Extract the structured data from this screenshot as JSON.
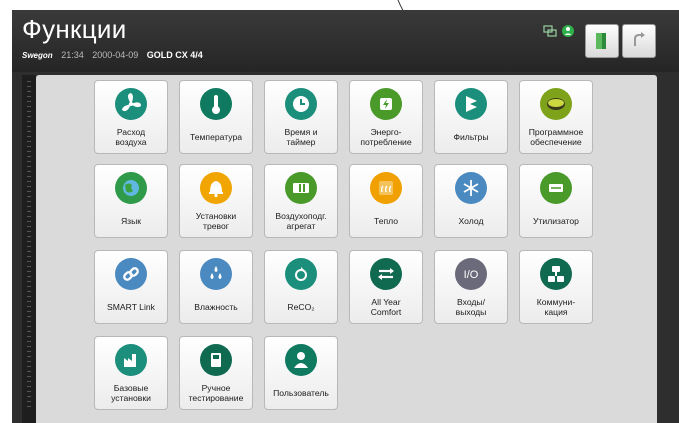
{
  "header": {
    "title": "Функции",
    "logo": "Swegon",
    "time": "21:34",
    "date": "2000-04-09",
    "model": "GOLD CX 4/4"
  },
  "status": {
    "network_icon": "network-icon",
    "user_icon": "user-status-icon"
  },
  "toolbar": {
    "exit_icon": "exit-door-icon",
    "back_icon": "back-arrow-icon"
  },
  "colors": {
    "tile_icon": "#0f7a60",
    "panel": "#dadada",
    "frame": "#2e2e2e"
  },
  "tiles": [
    {
      "label": "Расход\nвоздуха",
      "icon": "fan-icon",
      "color": "#1b8f7b"
    },
    {
      "label": "Температура",
      "icon": "thermometer-icon",
      "color": "#0f7a60"
    },
    {
      "label": "Время и\nтаймер",
      "icon": "clock-icon",
      "color": "#1b8f7b"
    },
    {
      "label": "Энерго-\nпотребление",
      "icon": "energy-icon",
      "color": "#4a9a2a"
    },
    {
      "label": "Фильтры",
      "icon": "filter-icon",
      "color": "#1b8f7b"
    },
    {
      "label": "Программное\nобеспечение",
      "icon": "chip-icon",
      "color": "#7ea21a"
    },
    {
      "label": "Язык",
      "icon": "globe-icon",
      "color": "#2e9a4a"
    },
    {
      "label": "Установки\nтревог",
      "icon": "bell-icon",
      "color": "#f0a500"
    },
    {
      "label": "Воздухоподг.\nагрегат",
      "icon": "air-unit-icon",
      "color": "#4a9a2a"
    },
    {
      "label": "Тепло",
      "icon": "heat-icon",
      "color": "#f0a000"
    },
    {
      "label": "Холод",
      "icon": "snowflake-icon",
      "color": "#4a8ac0"
    },
    {
      "label": "Утилизатор",
      "icon": "heat-exchanger-icon",
      "color": "#4a9a2a"
    },
    {
      "label": "SMART Link",
      "icon": "link-icon",
      "color": "#4a8ac0"
    },
    {
      "label": "Влажность",
      "icon": "droplets-icon",
      "color": "#4a8ac0"
    },
    {
      "label": "ReCO₂",
      "icon": "reco2-icon",
      "color": "#1b8f7b"
    },
    {
      "label": "All Year\nComfort",
      "icon": "all-year-comfort-icon",
      "color": "#0f6a50"
    },
    {
      "label": "Входы/\nвыходы",
      "icon": "io-icon",
      "color": "#6a6a7a"
    },
    {
      "label": "Коммуни-\nкация",
      "icon": "communication-icon",
      "color": "#0f6a50"
    },
    {
      "label": "Базовые\nустановки",
      "icon": "factory-icon",
      "color": "#1b8f7b"
    },
    {
      "label": "Ручное\nтестирование",
      "icon": "manual-test-icon",
      "color": "#0f6a50"
    },
    {
      "label": "Пользователь",
      "icon": "user-icon",
      "color": "#0f7a60"
    }
  ]
}
